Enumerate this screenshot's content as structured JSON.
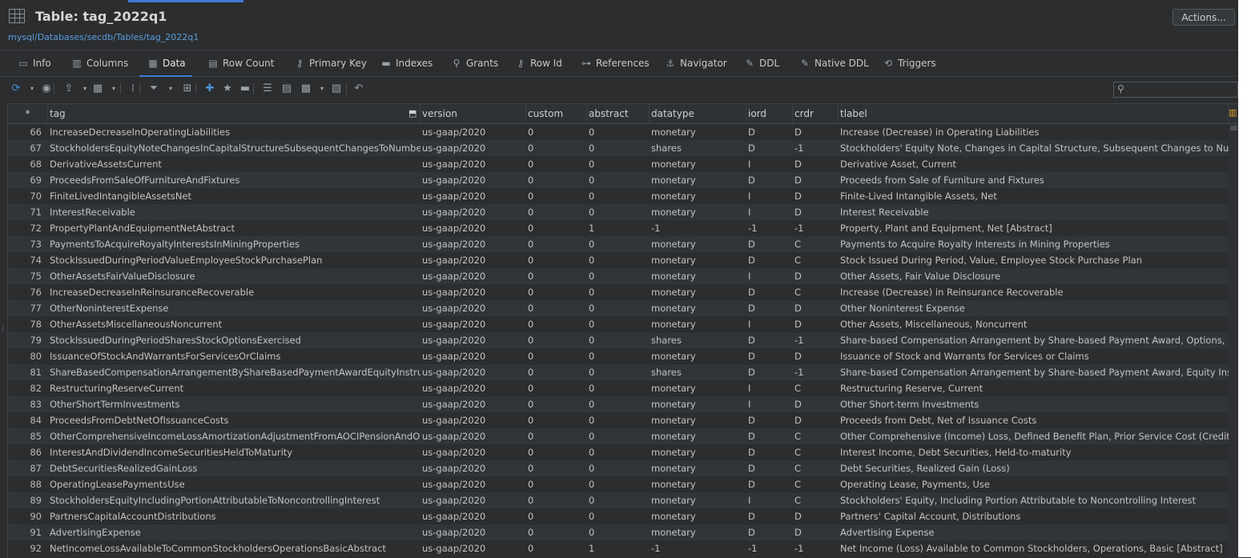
{
  "window": {
    "title": "Table: tag_2022q1",
    "path": "mysql/Databases/secdb/Tables/tag_2022q1",
    "actions_label": "Actions..."
  },
  "tabs": [
    {
      "label": "Info",
      "icon": "info-icon",
      "glyph": "▭"
    },
    {
      "label": "Columns",
      "icon": "columns-icon",
      "glyph": "▥"
    },
    {
      "label": "Data",
      "icon": "grid-icon",
      "glyph": "▦",
      "active": true
    },
    {
      "label": "Row Count",
      "icon": "row-count-icon",
      "glyph": "▤"
    },
    {
      "label": "Primary Key",
      "icon": "key-icon",
      "glyph": "⚷"
    },
    {
      "label": "Indexes",
      "icon": "indexes-icon",
      "glyph": "▬"
    },
    {
      "label": "Grants",
      "icon": "grants-icon",
      "glyph": "⚲"
    },
    {
      "label": "Row Id",
      "icon": "row-id-icon",
      "glyph": "⚷"
    },
    {
      "label": "References",
      "icon": "references-icon",
      "glyph": "⊶"
    },
    {
      "label": "Navigator",
      "icon": "navigator-icon",
      "glyph": "⚓"
    },
    {
      "label": "DDL",
      "icon": "ddl-icon",
      "glyph": "✎"
    },
    {
      "label": "Native DDL",
      "icon": "native-ddl-icon",
      "glyph": "✎"
    },
    {
      "label": "Triggers",
      "icon": "triggers-icon",
      "glyph": "⟲"
    }
  ],
  "toolbar": [
    {
      "icon": "refresh-icon",
      "glyph": "⟳",
      "blue": true
    },
    {
      "icon": "dropdown-icon",
      "glyph": "▾",
      "dd": true
    },
    {
      "icon": "stop-icon",
      "glyph": "◉"
    },
    {
      "icon": "export-icon",
      "glyph": "⇪"
    },
    {
      "icon": "dropdown-icon",
      "glyph": "▾",
      "dd": true
    },
    {
      "icon": "grid-view-icon",
      "glyph": "▦"
    },
    {
      "icon": "dropdown-icon",
      "glyph": "▾",
      "dd": true
    },
    {
      "icon": "sep-icon",
      "glyph": "⁞"
    },
    {
      "icon": "filter-icon",
      "glyph": "⏷"
    },
    {
      "icon": "dropdown-icon",
      "glyph": "▾",
      "dd": true
    },
    {
      "icon": "filter-edit-icon",
      "glyph": "⊞"
    },
    {
      "icon": "add-row-icon",
      "glyph": "✚",
      "blue": true
    },
    {
      "icon": "star-icon",
      "glyph": "★"
    },
    {
      "icon": "delete-row-icon",
      "glyph": "▬"
    },
    {
      "icon": "form-view-icon",
      "glyph": "☰"
    },
    {
      "icon": "calendar-grid-icon",
      "glyph": "▤"
    },
    {
      "icon": "layout-icon",
      "glyph": "▩"
    },
    {
      "icon": "dropdown-icon",
      "glyph": "▾",
      "dd": true
    },
    {
      "icon": "table-settings-icon",
      "glyph": "▧"
    },
    {
      "icon": "undo-icon",
      "glyph": "↶"
    }
  ],
  "columns": [
    {
      "key": "rownum",
      "label": "*"
    },
    {
      "key": "tag",
      "label": "tag"
    },
    {
      "key": "version",
      "label": "version"
    },
    {
      "key": "custom",
      "label": "custom"
    },
    {
      "key": "abstract",
      "label": "abstract"
    },
    {
      "key": "datatype",
      "label": "datatype"
    },
    {
      "key": "iord",
      "label": "iord"
    },
    {
      "key": "crdr",
      "label": "crdr"
    },
    {
      "key": "tlabel",
      "label": "tlabel"
    }
  ],
  "rows": [
    [
      "66",
      "IncreaseDecreaseInOperatingLiabilities",
      "us-gaap/2020",
      "0",
      "0",
      "monetary",
      "D",
      "D",
      "Increase (Decrease) in Operating Liabilities"
    ],
    [
      "67",
      "StockholdersEquityNoteChangesInCapitalStructureSubsequentChangesToNumberOf...",
      "us-gaap/2020",
      "0",
      "0",
      "shares",
      "D",
      "-1",
      "Stockholders' Equity Note, Changes in Capital Structure, Subsequent Changes to Number of"
    ],
    [
      "68",
      "DerivativeAssetsCurrent",
      "us-gaap/2020",
      "0",
      "0",
      "monetary",
      "I",
      "D",
      "Derivative Asset, Current"
    ],
    [
      "69",
      "ProceedsFromSaleOfFurnitureAndFixtures",
      "us-gaap/2020",
      "0",
      "0",
      "monetary",
      "D",
      "D",
      "Proceeds from Sale of Furniture and Fixtures"
    ],
    [
      "70",
      "FiniteLivedIntangibleAssetsNet",
      "us-gaap/2020",
      "0",
      "0",
      "monetary",
      "I",
      "D",
      "Finite-Lived Intangible Assets, Net"
    ],
    [
      "71",
      "InterestReceivable",
      "us-gaap/2020",
      "0",
      "0",
      "monetary",
      "I",
      "D",
      "Interest Receivable"
    ],
    [
      "72",
      "PropertyPlantAndEquipmentNetAbstract",
      "us-gaap/2020",
      "0",
      "1",
      "-1",
      "-1",
      "-1",
      "Property, Plant and Equipment, Net [Abstract]"
    ],
    [
      "73",
      "PaymentsToAcquireRoyaltyInterestsInMiningProperties",
      "us-gaap/2020",
      "0",
      "0",
      "monetary",
      "D",
      "C",
      "Payments to Acquire Royalty Interests in Mining Properties"
    ],
    [
      "74",
      "StockIssuedDuringPeriodValueEmployeeStockPurchasePlan",
      "us-gaap/2020",
      "0",
      "0",
      "monetary",
      "D",
      "C",
      "Stock Issued During Period, Value, Employee Stock Purchase Plan"
    ],
    [
      "75",
      "OtherAssetsFairValueDisclosure",
      "us-gaap/2020",
      "0",
      "0",
      "monetary",
      "I",
      "D",
      "Other Assets, Fair Value Disclosure"
    ],
    [
      "76",
      "IncreaseDecreaseInReinsuranceRecoverable",
      "us-gaap/2020",
      "0",
      "0",
      "monetary",
      "D",
      "C",
      "Increase (Decrease) in Reinsurance Recoverable"
    ],
    [
      "77",
      "OtherNoninterestExpense",
      "us-gaap/2020",
      "0",
      "0",
      "monetary",
      "D",
      "D",
      "Other Noninterest Expense"
    ],
    [
      "78",
      "OtherAssetsMiscellaneousNoncurrent",
      "us-gaap/2020",
      "0",
      "0",
      "monetary",
      "I",
      "D",
      "Other Assets, Miscellaneous, Noncurrent"
    ],
    [
      "79",
      "StockIssuedDuringPeriodSharesStockOptionsExercised",
      "us-gaap/2020",
      "0",
      "0",
      "shares",
      "D",
      "-1",
      "Share-based Compensation Arrangement by Share-based Payment Award, Options, Exercise"
    ],
    [
      "80",
      "IssuanceOfStockAndWarrantsForServicesOrClaims",
      "us-gaap/2020",
      "0",
      "0",
      "monetary",
      "D",
      "D",
      "Issuance of Stock and Warrants for Services or Claims"
    ],
    [
      "81",
      "ShareBasedCompensationArrangementByShareBasedPaymentAwardEquityInstrument...",
      "us-gaap/2020",
      "0",
      "0",
      "shares",
      "D",
      "-1",
      "Share-based Compensation Arrangement by Share-based Payment Award, Equity Instrumen"
    ],
    [
      "82",
      "RestructuringReserveCurrent",
      "us-gaap/2020",
      "0",
      "0",
      "monetary",
      "I",
      "C",
      "Restructuring Reserve, Current"
    ],
    [
      "83",
      "OtherShortTermInvestments",
      "us-gaap/2020",
      "0",
      "0",
      "monetary",
      "I",
      "D",
      "Other Short-term Investments"
    ],
    [
      "84",
      "ProceedsFromDebtNetOfIssuanceCosts",
      "us-gaap/2020",
      "0",
      "0",
      "monetary",
      "D",
      "D",
      "Proceeds from Debt, Net of Issuance Costs"
    ],
    [
      "85",
      "OtherComprehensiveIncomeLossAmortizationAdjustmentFromAOCIPensionAndOthe...",
      "us-gaap/2020",
      "0",
      "0",
      "monetary",
      "D",
      "C",
      "Other Comprehensive (Income) Loss, Defined Benefit Plan, Prior Service Cost (Credit), Reclas"
    ],
    [
      "86",
      "InterestAndDividendIncomeSecuritiesHeldToMaturity",
      "us-gaap/2020",
      "0",
      "0",
      "monetary",
      "D",
      "C",
      "Interest Income, Debt Securities, Held-to-maturity"
    ],
    [
      "87",
      "DebtSecuritiesRealizedGainLoss",
      "us-gaap/2020",
      "0",
      "0",
      "monetary",
      "D",
      "C",
      "Debt Securities, Realized Gain (Loss)"
    ],
    [
      "88",
      "OperatingLeasePaymentsUse",
      "us-gaap/2020",
      "0",
      "0",
      "monetary",
      "D",
      "C",
      "Operating Lease, Payments, Use"
    ],
    [
      "89",
      "StockholdersEquityIncludingPortionAttributableToNoncontrollingInterest",
      "us-gaap/2020",
      "0",
      "0",
      "monetary",
      "I",
      "C",
      "Stockholders' Equity, Including Portion Attributable to Noncontrolling Interest"
    ],
    [
      "90",
      "PartnersCapitalAccountDistributions",
      "us-gaap/2020",
      "0",
      "0",
      "monetary",
      "D",
      "D",
      "Partners' Capital Account, Distributions"
    ],
    [
      "91",
      "AdvertisingExpense",
      "us-gaap/2020",
      "0",
      "0",
      "monetary",
      "D",
      "D",
      "Advertising Expense"
    ],
    [
      "92",
      "NetIncomeLossAvailableToCommonStockholdersOperationsBasicAbstract",
      "us-gaap/2020",
      "0",
      "1",
      "-1",
      "-1",
      "-1",
      "Net Income (Loss) Available to Common Stockholders, Operations, Basic [Abstract]"
    ]
  ]
}
